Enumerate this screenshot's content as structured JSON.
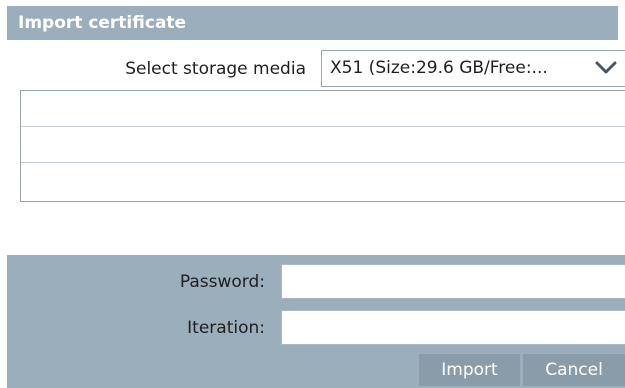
{
  "dialog": {
    "title": "Import certificate"
  },
  "storage": {
    "label": "Select storage media",
    "selected_value": "X51 (Size:29.6 GB/Free:..."
  },
  "file_list": {
    "rows": [
      "",
      "",
      ""
    ]
  },
  "fields": {
    "password_label": "Password:",
    "password_value": "",
    "iteration_label": "Iteration:",
    "iteration_value": ""
  },
  "buttons": {
    "import_label": "Import",
    "cancel_label": "Cancel"
  },
  "colors": {
    "panel": "#9aaebc",
    "button": "#8a9ca9",
    "border": "#9aa5ad"
  },
  "icons": {
    "dropdown": "chevron-down-icon"
  }
}
